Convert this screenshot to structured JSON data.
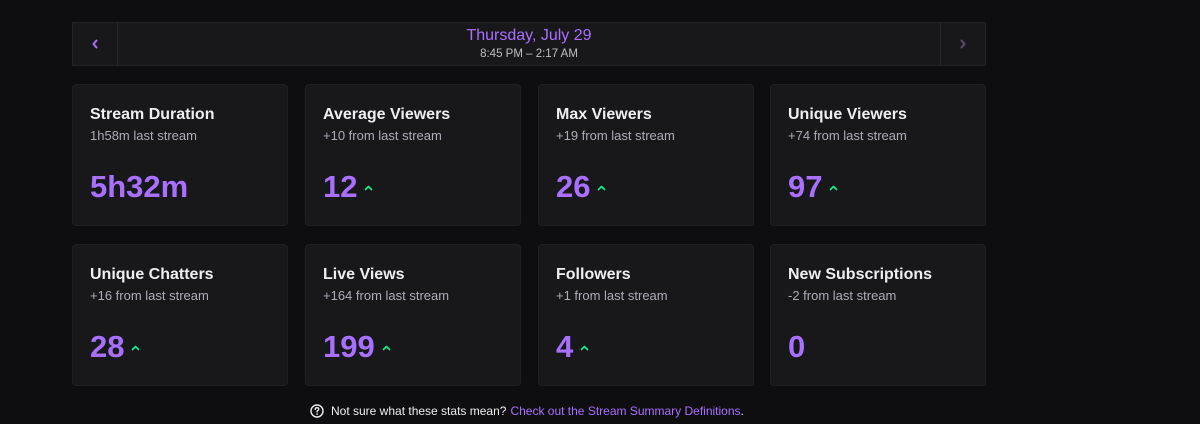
{
  "header": {
    "date": "Thursday, July 29",
    "time_range": "8:45 PM – 2:17 AM",
    "prev_icon": "chevron-left-icon",
    "next_icon": "chevron-right-icon"
  },
  "colors": {
    "accent": "#a970ff",
    "trend_up": "#00f593",
    "background": "#0e0e10",
    "card": "#18181b"
  },
  "cards": [
    {
      "title": "Stream Duration",
      "subtitle": "1h58m last stream",
      "value": "5h32m",
      "trend": "none"
    },
    {
      "title": "Average Viewers",
      "subtitle": "+10 from last stream",
      "value": "12",
      "trend": "up"
    },
    {
      "title": "Max Viewers",
      "subtitle": "+19 from last stream",
      "value": "26",
      "trend": "up"
    },
    {
      "title": "Unique Viewers",
      "subtitle": "+74 from last stream",
      "value": "97",
      "trend": "up"
    },
    {
      "title": "Unique Chatters",
      "subtitle": "+16 from last stream",
      "value": "28",
      "trend": "up"
    },
    {
      "title": "Live Views",
      "subtitle": "+164 from last stream",
      "value": "199",
      "trend": "up"
    },
    {
      "title": "Followers",
      "subtitle": "+1 from last stream",
      "value": "4",
      "trend": "up"
    },
    {
      "title": "New Subscriptions",
      "subtitle": "-2 from last stream",
      "value": "0",
      "trend": "none"
    }
  ],
  "footer": {
    "question": "Not sure what these stats mean?",
    "link": "Check out the Stream Summary Definitions",
    "suffix": ".",
    "icon": "help-circle-icon"
  }
}
